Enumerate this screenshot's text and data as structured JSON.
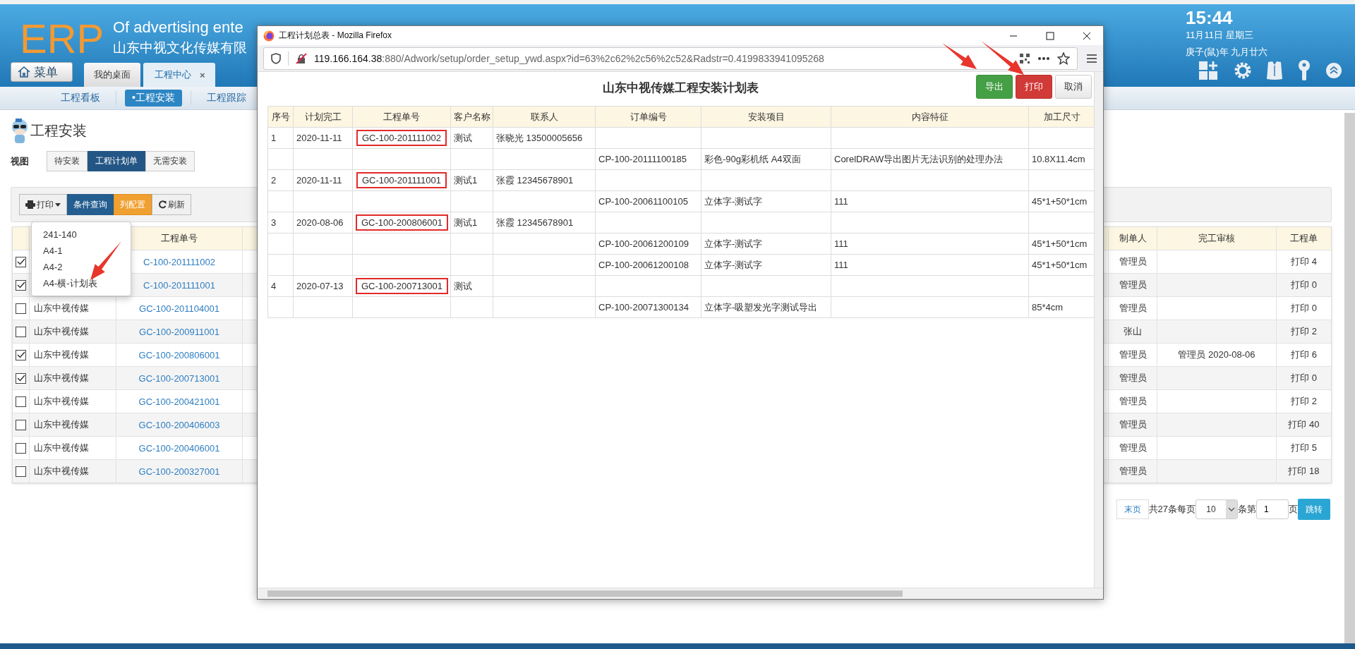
{
  "header": {
    "logo": "ERP",
    "slogan": "Of advertising ente",
    "company": "山东中视文化传媒有限",
    "time": "15:44",
    "date": "11月11日 星期三",
    "lunar": "庚子(鼠)年 九月廿六"
  },
  "menu_button": "菜单",
  "tabs": [
    {
      "label": "我的桌面",
      "selected": false
    },
    {
      "label": "工程中心",
      "selected": true,
      "close": "×"
    }
  ],
  "subnav": [
    {
      "label": "工程看板",
      "selected": false
    },
    {
      "label": "•工程安装",
      "selected": true
    },
    {
      "label": "工程跟踪",
      "selected": false
    }
  ],
  "page_title": "工程安装",
  "view": {
    "label": "视图",
    "options": [
      {
        "label": "待安装",
        "selected": false
      },
      {
        "label": "工程计划单",
        "selected": true
      },
      {
        "label": "无需安装",
        "selected": false
      }
    ]
  },
  "toolbar": [
    {
      "kind": "dropdown",
      "label": "打印"
    },
    {
      "kind": "primary",
      "label": "条件查询"
    },
    {
      "kind": "warning",
      "label": "列配置"
    },
    {
      "kind": "refresh",
      "label": "刷新"
    }
  ],
  "print_menu": [
    "241-140",
    "A4-1",
    "A4-2",
    "A4-横-计划表"
  ],
  "table": {
    "columns": {
      "order_no": "工程单号",
      "maker": "制单人",
      "review": "完工审核",
      "print": "工程单"
    },
    "rows": [
      {
        "checked": true,
        "order_no": "C-100-201111002",
        "maker": "管理员",
        "print": "打印 4"
      },
      {
        "checked": true,
        "order_no": "C-100-201111001",
        "maker": "管理员",
        "print": "打印 0"
      },
      {
        "checked": false,
        "customer": "山东中视传媒",
        "order_no": "GC-100-201104001",
        "maker": "管理员",
        "print": "打印 0"
      },
      {
        "checked": false,
        "customer": "山东中视传媒",
        "order_no": "GC-100-200911001",
        "maker": "张山",
        "print": "打印 2"
      },
      {
        "checked": true,
        "customer": "山东中视传媒",
        "order_no": "GC-100-200806001",
        "maker": "管理员",
        "review": "管理员 2020-08-06",
        "print": "打印 6"
      },
      {
        "checked": true,
        "customer": "山东中视传媒",
        "order_no": "GC-100-200713001",
        "maker": "管理员",
        "print": "打印 0"
      },
      {
        "checked": false,
        "customer": "山东中视传媒",
        "order_no": "GC-100-200421001",
        "maker": "管理员",
        "print": "打印 2"
      },
      {
        "checked": false,
        "customer": "山东中视传媒",
        "order_no": "GC-100-200406003",
        "maker": "管理员",
        "print": "打印 40"
      },
      {
        "checked": false,
        "customer": "山东中视传媒",
        "order_no": "GC-100-200406001",
        "maker": "管理员",
        "print": "打印 5"
      },
      {
        "checked": false,
        "customer": "山东中视传媒",
        "order_no": "GC-100-200327001",
        "maker": "管理员",
        "print": "打印 18"
      }
    ]
  },
  "pagination": {
    "last": "末页",
    "total": "共27条每页",
    "page_size": "10",
    "items_label": "条第",
    "page": "1",
    "page_suffix": "页",
    "go": "跳转"
  },
  "popup": {
    "title": "工程计划总表 - Mozilla Firefox",
    "url_host": "119.166.164.38",
    "url_rest": ":880/Adwork/setup/order_setup_ywd.aspx?id=63%2c62%2c56%2c52&Radstr=0.4199833941095268",
    "heading": "山东中视传媒工程安装计划表",
    "buttons": [
      {
        "kind": "success",
        "label": "导出"
      },
      {
        "kind": "danger",
        "label": "打印"
      },
      {
        "kind": "default",
        "label": "取消"
      }
    ],
    "columns": [
      "序号",
      "计划完工",
      "工程单号",
      "客户名称",
      "联系人",
      "订单编号",
      "安装项目",
      "内容特征",
      "加工尺寸"
    ],
    "rows": [
      {
        "no": "1",
        "date": "2020-11-11",
        "project": "GC-100-201111002",
        "customer": "测试",
        "contact": "张晓光 13500005656",
        "highlighted": true
      },
      {
        "order": "CP-100-20111100185",
        "item": "彩色-90g彩机纸 A4双面",
        "feature": "CorelDRAW导出图片无法识别的处理办法",
        "size": "10.8X11.4cm"
      },
      {
        "no": "2",
        "date": "2020-11-11",
        "project": "GC-100-201111001",
        "customer": "测试1",
        "contact": "张霞 12345678901",
        "highlighted": true
      },
      {
        "order": "CP-100-20061100105",
        "item": "立体字-测试字",
        "feature": "111",
        "size": "45*1+50*1cm"
      },
      {
        "no": "3",
        "date": "2020-08-06",
        "project": "GC-100-200806001",
        "customer": "测试1",
        "contact": "张霞 12345678901",
        "highlighted": true
      },
      {
        "order": "CP-100-20061200109",
        "item": "立体字-测试字",
        "feature": "111",
        "size": "45*1+50*1cm"
      },
      {
        "order": "CP-100-20061200108",
        "item": "立体字-测试字",
        "feature": "111",
        "size": "45*1+50*1cm"
      },
      {
        "no": "4",
        "date": "2020-07-13",
        "project": "GC-100-200713001",
        "customer": "测试",
        "highlighted": true
      },
      {
        "order": "CP-100-20071300134",
        "item": "立体字-吸塑发光字测试导出",
        "size": "85*4cm"
      }
    ]
  }
}
